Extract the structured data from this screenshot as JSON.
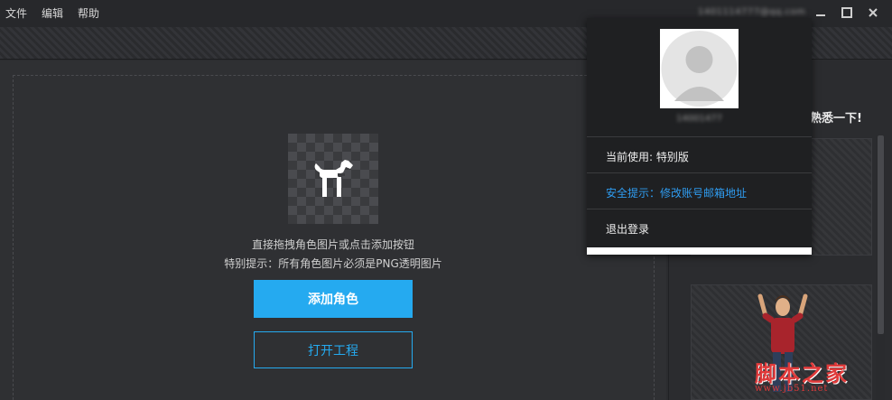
{
  "menu": {
    "items": [
      {
        "label": "文件"
      },
      {
        "label": "编辑"
      },
      {
        "label": "帮助"
      }
    ]
  },
  "header": {
    "account": "1401114777@qq.com"
  },
  "window_controls": {
    "icons": [
      "minimize-icon",
      "maximize-icon",
      "close-icon"
    ]
  },
  "main": {
    "hint_line1": "直接拖拽角色图片或点击添加按钮",
    "hint_line2": "特别提示：所有角色图片必须是PNG透明图片",
    "add_button": "添加角色",
    "open_button": "打开工程",
    "preview_icon": "dog-icon"
  },
  "right_panel": {
    "title": "熟悉一下!"
  },
  "popup": {
    "username": "14001477",
    "current_use": "当前使用: 特别版",
    "security_tip": "安全提示：修改账号邮箱地址",
    "logout": "退出登录"
  },
  "watermark": {
    "text": "脚本之家",
    "url": "www.jb51.net"
  },
  "colors": {
    "accent": "#25aaf0",
    "link": "#2f9cf0",
    "watermark": "#e03a3a"
  }
}
